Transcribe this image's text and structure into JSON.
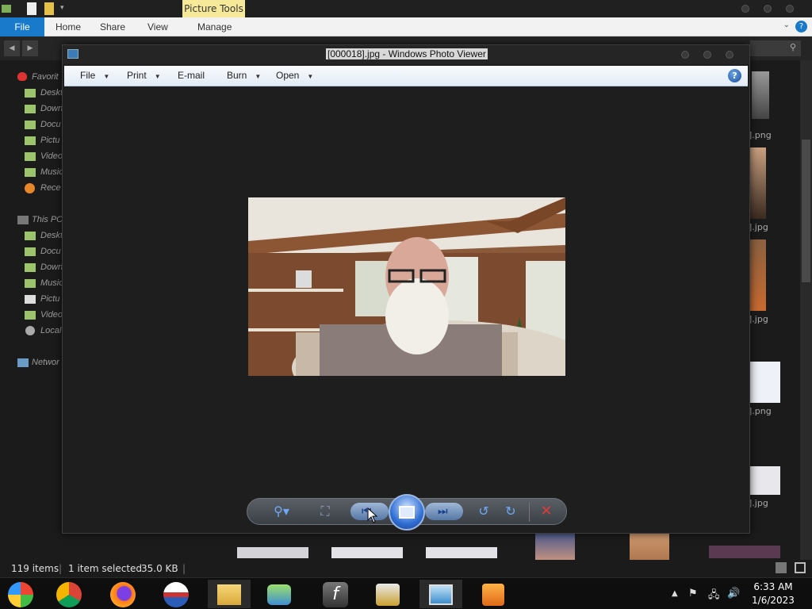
{
  "explorer": {
    "picture_tools": "Picture Tools",
    "ribbon_tabs": [
      "File",
      "Home",
      "Share",
      "View",
      "Manage"
    ],
    "nav": [
      {
        "label": "Favorit",
        "y": 0
      },
      {
        "label": "Deskt"
      },
      {
        "label": "Down"
      },
      {
        "label": "Docu"
      },
      {
        "label": "Pictu"
      },
      {
        "label": "Video"
      },
      {
        "label": "Music"
      },
      {
        "label": "Rece"
      },
      {
        "label": "This PC"
      },
      {
        "label": "Deskt"
      },
      {
        "label": "Docu"
      },
      {
        "label": "Down"
      },
      {
        "label": "Music"
      },
      {
        "label": "Pictu"
      },
      {
        "label": "Video"
      },
      {
        "label": "Local"
      },
      {
        "label": "Networ"
      }
    ],
    "thumb_labels": [
      "].png",
      "].jpg",
      "].jpg",
      "].png",
      "].jpg"
    ],
    "status": {
      "items": "119 items",
      "selected": "1 item selected",
      "size": "35.0 KB"
    }
  },
  "viewer": {
    "title": "[000018].jpg - Windows Photo Viewer",
    "menus": {
      "file": "File",
      "print": "Print",
      "email": "E-mail",
      "burn": "Burn",
      "open": "Open"
    },
    "help": "?"
  },
  "taskbar": {
    "time": "6:33 AM",
    "date": "1/6/2023"
  }
}
